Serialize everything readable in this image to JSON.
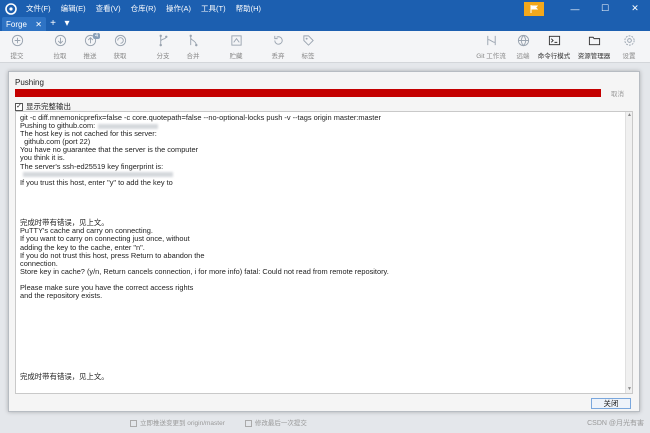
{
  "titlebar": {
    "menu": [
      "文件(F)",
      "编辑(E)",
      "查看(V)",
      "仓库(R)",
      "操作(A)",
      "工具(T)",
      "帮助(H)"
    ]
  },
  "tabs": [
    {
      "label": "Forge"
    }
  ],
  "toolbar": {
    "items": [
      {
        "label": "提交",
        "icon": "commit-icon"
      },
      {
        "label": "拉取",
        "icon": "pull-icon"
      },
      {
        "label": "推送",
        "icon": "push-icon",
        "badge": "4"
      },
      {
        "label": "获取",
        "icon": "fetch-icon"
      },
      {
        "label": "分支",
        "icon": "branch-icon"
      },
      {
        "label": "合并",
        "icon": "merge-icon"
      },
      {
        "label": "贮藏",
        "icon": "stash-icon"
      },
      {
        "label": "丢弃",
        "icon": "discard-icon"
      },
      {
        "label": "标签",
        "icon": "tag-icon"
      },
      {
        "label": "Git 工作流",
        "icon": "git-flow-icon"
      },
      {
        "label": "远端",
        "icon": "remote-icon"
      },
      {
        "label": "命令行模式",
        "icon": "terminal-icon"
      },
      {
        "label": "资源管理器",
        "icon": "explorer-icon"
      },
      {
        "label": "设置",
        "icon": "settings-icon"
      }
    ]
  },
  "dialog": {
    "title": "Pushing",
    "cancel_label": "取消",
    "progress": 1.0,
    "progress_color": "#c40000",
    "show_output_label": "显示完整输出",
    "show_output_checked": true,
    "output_lines": [
      "git -c diff.mnemonicprefix=false -c core.quotepath=false --no-optional-locks push -v --tags origin master:master",
      "Pushing to github.com:",
      "The host key is not cached for this server:",
      "  github.com (port 22)",
      "You have no guarantee that the server is the computer",
      "you think it is.",
      "The server's ssh-ed25519 key fingerprint is:",
      "",
      "If you trust this host, enter \"y\" to add the key to",
      "",
      "",
      "",
      "",
      "完成时带有错误，见上文。",
      "PuTTY's cache and carry on connecting.",
      "If you want to carry on connecting just once, without",
      "adding the key to the cache, enter \"n\".",
      "If you do not trust this host, press Return to abandon the",
      "connection.",
      "Store key in cache? (y/n, Return cancels connection, i for more info) fatal: Could not read from remote repository.",
      "",
      "Please make sure you have the correct access rights",
      "and the repository exists.",
      "",
      "",
      "",
      "",
      "",
      "",
      "",
      "",
      "",
      "完成时带有错误，见上文。"
    ],
    "close_label": "关闭"
  },
  "background": {
    "check1_label": "立即推送变更到 origin/master",
    "check2_label": "修改最后一次提交"
  },
  "watermark": "CSDN @月光有害"
}
